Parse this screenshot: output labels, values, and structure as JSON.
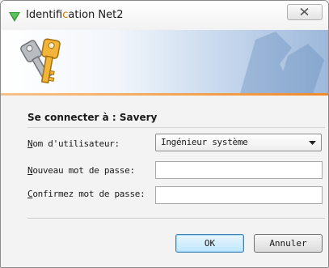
{
  "window": {
    "title_prefix": "Identif",
    "title_highlight": "ic",
    "title_suffix": "ation Net2",
    "close_icon": "close-icon"
  },
  "banner": {
    "icon": "keys-icon",
    "accent_color": "#f08a2a"
  },
  "form": {
    "connect_label": "Se connecter à : Savery",
    "user_label": "Nom d'utilisateur:",
    "user_value": "Ingénieur système",
    "new_password_label": "Nouveau mot de passe:",
    "new_password_value": "",
    "confirm_password_label": "Confirmez mot de passe:",
    "confirm_password_value": ""
  },
  "buttons": {
    "ok_label": "OK",
    "cancel_label": "Annuler"
  }
}
